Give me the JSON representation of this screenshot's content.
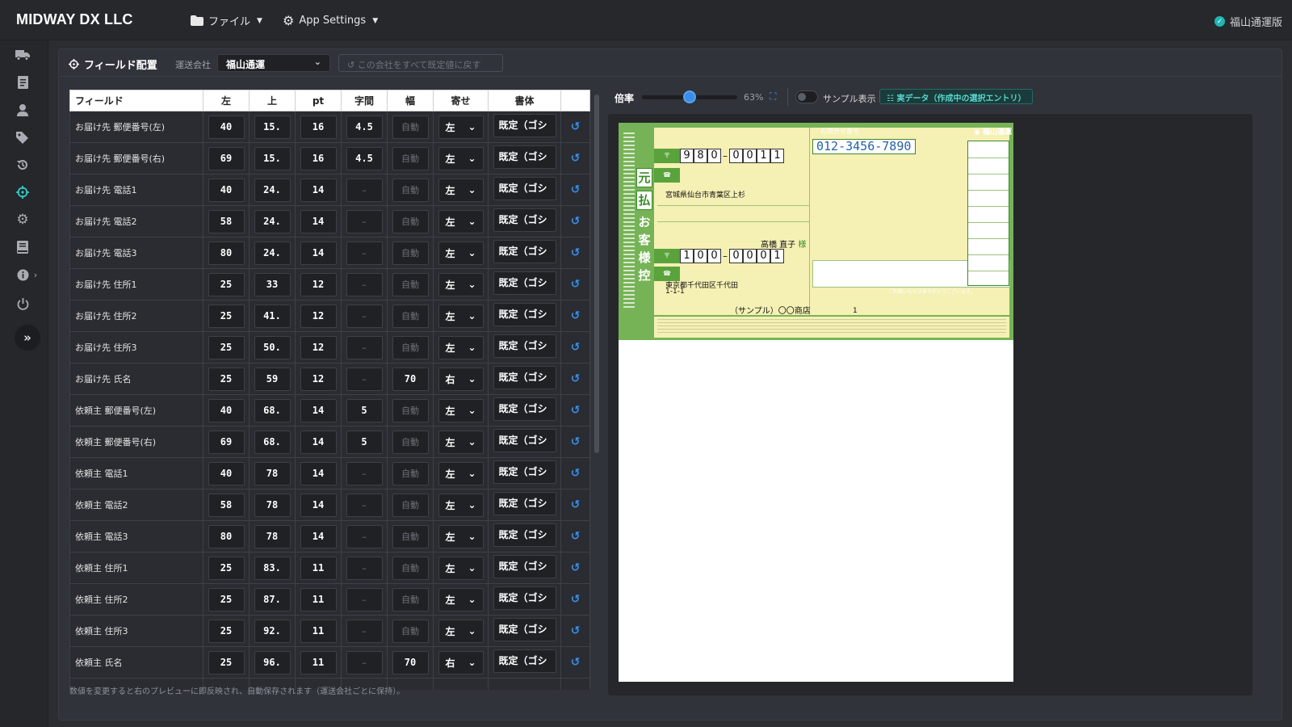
{
  "app": {
    "brand": "MIDWAY DX LLC",
    "menu_file": "ファイル",
    "menu_settings": "App Settings",
    "carrier_status": "福山通運版"
  },
  "sidebar": {
    "icons": [
      "truck-icon",
      "document-icon",
      "user-icon",
      "tags-icon",
      "history-icon",
      "crosshair-icon",
      "gear-icon",
      "book-icon",
      "info-icon",
      "power-icon"
    ],
    "active": "crosshair-icon"
  },
  "panel": {
    "title": "フィールド配置",
    "carrier_label": "運送会社",
    "carrier_value": "福山通運",
    "reset_all": "この会社をすべて既定値に戻す",
    "footer_note": "数値を変更すると右のプレビューに即反映され、自動保存されます（運送会社ごとに保持）。"
  },
  "table": {
    "headers": [
      "フィールド",
      "左",
      "上",
      "pt",
      "字間",
      "幅",
      "寄せ",
      "書体"
    ],
    "rows": [
      {
        "field": "お届け先 郵便番号(左)",
        "left": "40",
        "top": "15.",
        "pt": "16",
        "spacing": "4.5",
        "width": "自動",
        "align": "左",
        "font": "既定（ゴシ"
      },
      {
        "field": "お届け先 郵便番号(右)",
        "left": "69",
        "top": "15.",
        "pt": "16",
        "spacing": "4.5",
        "width": "自動",
        "align": "左",
        "font": "既定（ゴシ"
      },
      {
        "field": "お届け先 電話1",
        "left": "40",
        "top": "24.",
        "pt": "14",
        "spacing": "–",
        "width": "自動",
        "align": "左",
        "font": "既定（ゴシ"
      },
      {
        "field": "お届け先 電話2",
        "left": "58",
        "top": "24.",
        "pt": "14",
        "spacing": "–",
        "width": "自動",
        "align": "左",
        "font": "既定（ゴシ"
      },
      {
        "field": "お届け先 電話3",
        "left": "80",
        "top": "24.",
        "pt": "14",
        "spacing": "–",
        "width": "自動",
        "align": "左",
        "font": "既定（ゴシ"
      },
      {
        "field": "お届け先 住所1",
        "left": "25",
        "top": "33",
        "pt": "12",
        "spacing": "–",
        "width": "自動",
        "align": "左",
        "font": "既定（ゴシ"
      },
      {
        "field": "お届け先 住所2",
        "left": "25",
        "top": "41.",
        "pt": "12",
        "spacing": "–",
        "width": "自動",
        "align": "左",
        "font": "既定（ゴシ"
      },
      {
        "field": "お届け先 住所3",
        "left": "25",
        "top": "50.",
        "pt": "12",
        "spacing": "–",
        "width": "自動",
        "align": "左",
        "font": "既定（ゴシ"
      },
      {
        "field": "お届け先 氏名",
        "left": "25",
        "top": "59",
        "pt": "12",
        "spacing": "–",
        "width": "70",
        "align": "右",
        "font": "既定（ゴシ"
      },
      {
        "field": "依頼主 郵便番号(左)",
        "left": "40",
        "top": "68.",
        "pt": "14",
        "spacing": "5",
        "width": "自動",
        "align": "左",
        "font": "既定（ゴシ"
      },
      {
        "field": "依頼主 郵便番号(右)",
        "left": "69",
        "top": "68.",
        "pt": "14",
        "spacing": "5",
        "width": "自動",
        "align": "左",
        "font": "既定（ゴシ"
      },
      {
        "field": "依頼主 電話1",
        "left": "40",
        "top": "78",
        "pt": "14",
        "spacing": "–",
        "width": "自動",
        "align": "左",
        "font": "既定（ゴシ"
      },
      {
        "field": "依頼主 電話2",
        "left": "58",
        "top": "78",
        "pt": "14",
        "spacing": "–",
        "width": "自動",
        "align": "左",
        "font": "既定（ゴシ"
      },
      {
        "field": "依頼主 電話3",
        "left": "80",
        "top": "78",
        "pt": "14",
        "spacing": "–",
        "width": "自動",
        "align": "左",
        "font": "既定（ゴシ"
      },
      {
        "field": "依頼主 住所1",
        "left": "25",
        "top": "83.",
        "pt": "11",
        "spacing": "–",
        "width": "自動",
        "align": "左",
        "font": "既定（ゴシ"
      },
      {
        "field": "依頼主 住所2",
        "left": "25",
        "top": "87.",
        "pt": "11",
        "spacing": "–",
        "width": "自動",
        "align": "左",
        "font": "既定（ゴシ"
      },
      {
        "field": "依頼主 住所3",
        "left": "25",
        "top": "92.",
        "pt": "11",
        "spacing": "–",
        "width": "自動",
        "align": "左",
        "font": "既定（ゴシ"
      },
      {
        "field": "依頼主 氏名",
        "left": "25",
        "top": "96.",
        "pt": "11",
        "spacing": "–",
        "width": "70",
        "align": "右",
        "font": "既定（ゴシ"
      }
    ]
  },
  "preview": {
    "zoom_label": "倍率",
    "zoom_pct": "63%",
    "zoom_fraction": 0.5,
    "sample_label": "サンプル表示",
    "data_badge": "実データ（作成中の選択エントリ）",
    "slip": {
      "stamp_chars": [
        "元",
        "払",
        "お",
        "客",
        "様",
        "控"
      ],
      "inquiry_label": "お問合せ番号",
      "phone": "012-3456-7890",
      "logo": "福山通運",
      "to_zip_left": [
        "9",
        "8",
        "0"
      ],
      "to_zip_right": [
        "0",
        "0",
        "1",
        "1"
      ],
      "to_address": "宮城県仙台市青葉区上杉",
      "to_name": "高橋 直子",
      "sama": "様",
      "from_zip_left": [
        "1",
        "0",
        "0"
      ],
      "from_zip_right": [
        "0",
        "0",
        "0",
        "1"
      ],
      "from_address1": "東京都千代田区千代田",
      "from_address2": "1-1-1",
      "from_name": "（サンプル）〇〇商店",
      "pieces": "1",
      "notice": "ご利用いただきありがとうございます。"
    }
  },
  "colors": {
    "accent_teal": "#35c9c4",
    "accent_blue": "#3a8ee8",
    "slip_green": "#76b356"
  }
}
